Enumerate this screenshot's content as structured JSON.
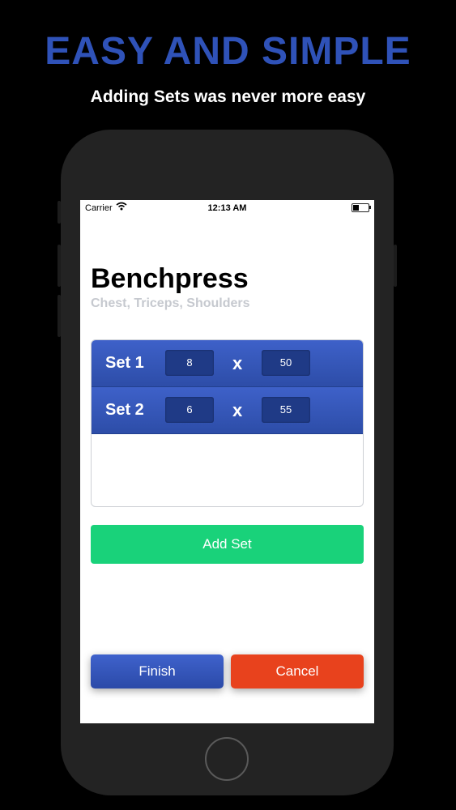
{
  "promo": {
    "headline": "EASY AND SIMPLE",
    "tagline": "Adding Sets was never more easy"
  },
  "statusbar": {
    "carrier": "Carrier",
    "time": "12:13 AM"
  },
  "exercise": {
    "title": "Benchpress",
    "muscles": "Chest, Triceps, Shoulders"
  },
  "sets": [
    {
      "label": "Set 1",
      "reps": "8",
      "separator": "x",
      "weight": "50"
    },
    {
      "label": "Set 2",
      "reps": "6",
      "separator": "x",
      "weight": "55"
    }
  ],
  "actions": {
    "add_set": "Add Set",
    "finish": "Finish",
    "cancel": "Cancel"
  },
  "colors": {
    "headline": "#2f52b8",
    "set_row": "#3355b8",
    "add_set": "#19d27a",
    "finish": "#3452b8",
    "cancel": "#e8421d"
  },
  "icons": [
    "wifi-icon",
    "battery-icon",
    "home-button"
  ]
}
